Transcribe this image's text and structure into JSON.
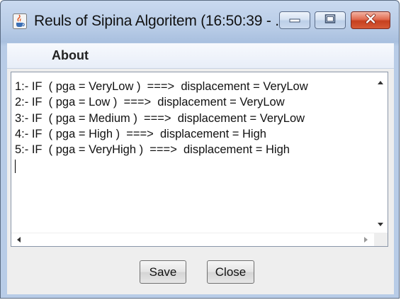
{
  "window": {
    "title": "Reuls of Sipina Algoritem (16:50:39 - ..."
  },
  "menu": {
    "items": [
      {
        "label": "About"
      }
    ]
  },
  "output": {
    "lines": [
      "1:- IF  ( pga = VeryLow )  ===>  displacement = VeryLow",
      "2:- IF  ( pga = Low )  ===>  displacement = VeryLow",
      "3:- IF  ( pga = Medium )  ===>  displacement = VeryLow",
      "4:- IF  ( pga = High )  ===>  displacement = High",
      "5:- IF  ( pga = VeryHigh )  ===>  displacement = High"
    ]
  },
  "buttons": {
    "save_label": "Save",
    "close_label": "Close"
  },
  "icons": {
    "app": "java-coffee-cup-icon",
    "minimize": "minimize-icon",
    "maximize": "maximize-icon",
    "close": "close-icon"
  },
  "colors": {
    "close_button": "#d65a36",
    "titlebar": "#b7cbe6"
  }
}
